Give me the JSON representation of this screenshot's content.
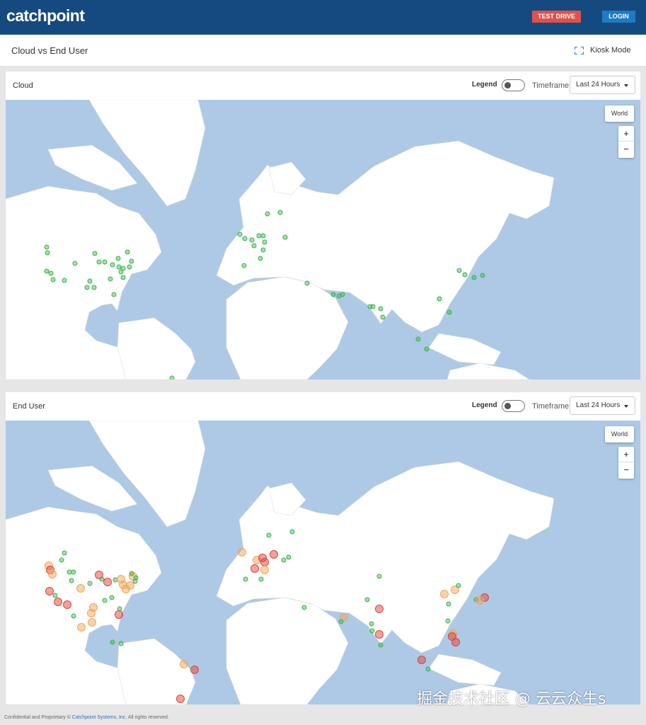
{
  "topbar": {
    "logo": "catchpoint",
    "test_drive": "TEST DRIVE",
    "login": "LOGIN"
  },
  "header": {
    "title": "Cloud vs End User",
    "kiosk_label": "Kiosk Mode"
  },
  "panels": [
    {
      "title": "Cloud",
      "legend_label": "Legend",
      "timeframe_label": "Timeframe",
      "timeframe_value": "Last 24 Hours",
      "map_region_button": "World",
      "zoom_in": "+",
      "zoom_out": "−"
    },
    {
      "title": "End User",
      "legend_label": "Legend",
      "timeframe_label": "Timeframe",
      "timeframe_value": "Last 24 Hours",
      "map_region_button": "World",
      "zoom_in": "+",
      "zoom_out": "−"
    }
  ],
  "footer": {
    "prefix": "Confidential and Proprietary ©",
    "company": "Catchpoint Systems, Inc.",
    "suffix": "All rights reserved."
  },
  "watermark": "掘金技术社区 @ 云云众生s",
  "colors": {
    "brand_bar": "#154a80",
    "test_drive": "#e0514a",
    "login": "#1f7bc2",
    "ocean": "#adc9e6",
    "land": "#ffffff",
    "status_good": "#39b54a",
    "status_warn": "#f2a65a",
    "status_bad": "#e0453a"
  },
  "icons": {
    "kiosk": "fullscreen-icon",
    "dropdown": "caret-down-icon",
    "toggle": "toggle-switch-icon"
  }
}
